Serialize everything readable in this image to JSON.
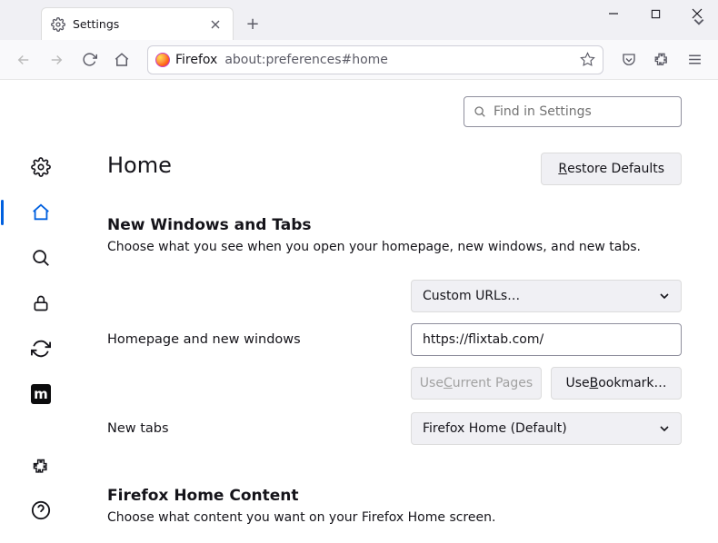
{
  "titlebar": {
    "tab_label": "Settings"
  },
  "toolbar": {
    "identity_label": "Firefox",
    "url": "about:preferences#home"
  },
  "search": {
    "placeholder": "Find in Settings"
  },
  "page": {
    "heading": "Home",
    "restore_prefix": "R",
    "restore_rest": "estore Defaults"
  },
  "section_windows": {
    "title": "New Windows and Tabs",
    "desc": "Choose what you see when you open your homepage, new windows, and new tabs.",
    "homepage_label": "Homepage and new windows",
    "homepage_dropdown": "Custom URLs…",
    "homepage_url": "https://flixtab.com/",
    "use_current_pre": "Use ",
    "use_current_u": "C",
    "use_current_post": "urrent Pages",
    "use_bookmark_pre": "Use ",
    "use_bookmark_u": "B",
    "use_bookmark_post": "ookmark…",
    "newtabs_label": "New tabs",
    "newtabs_dropdown": "Firefox Home (Default)"
  },
  "section_content": {
    "title": "Firefox Home Content",
    "desc": "Choose what content you want on your Firefox Home screen."
  },
  "icons": {
    "m": "m"
  }
}
